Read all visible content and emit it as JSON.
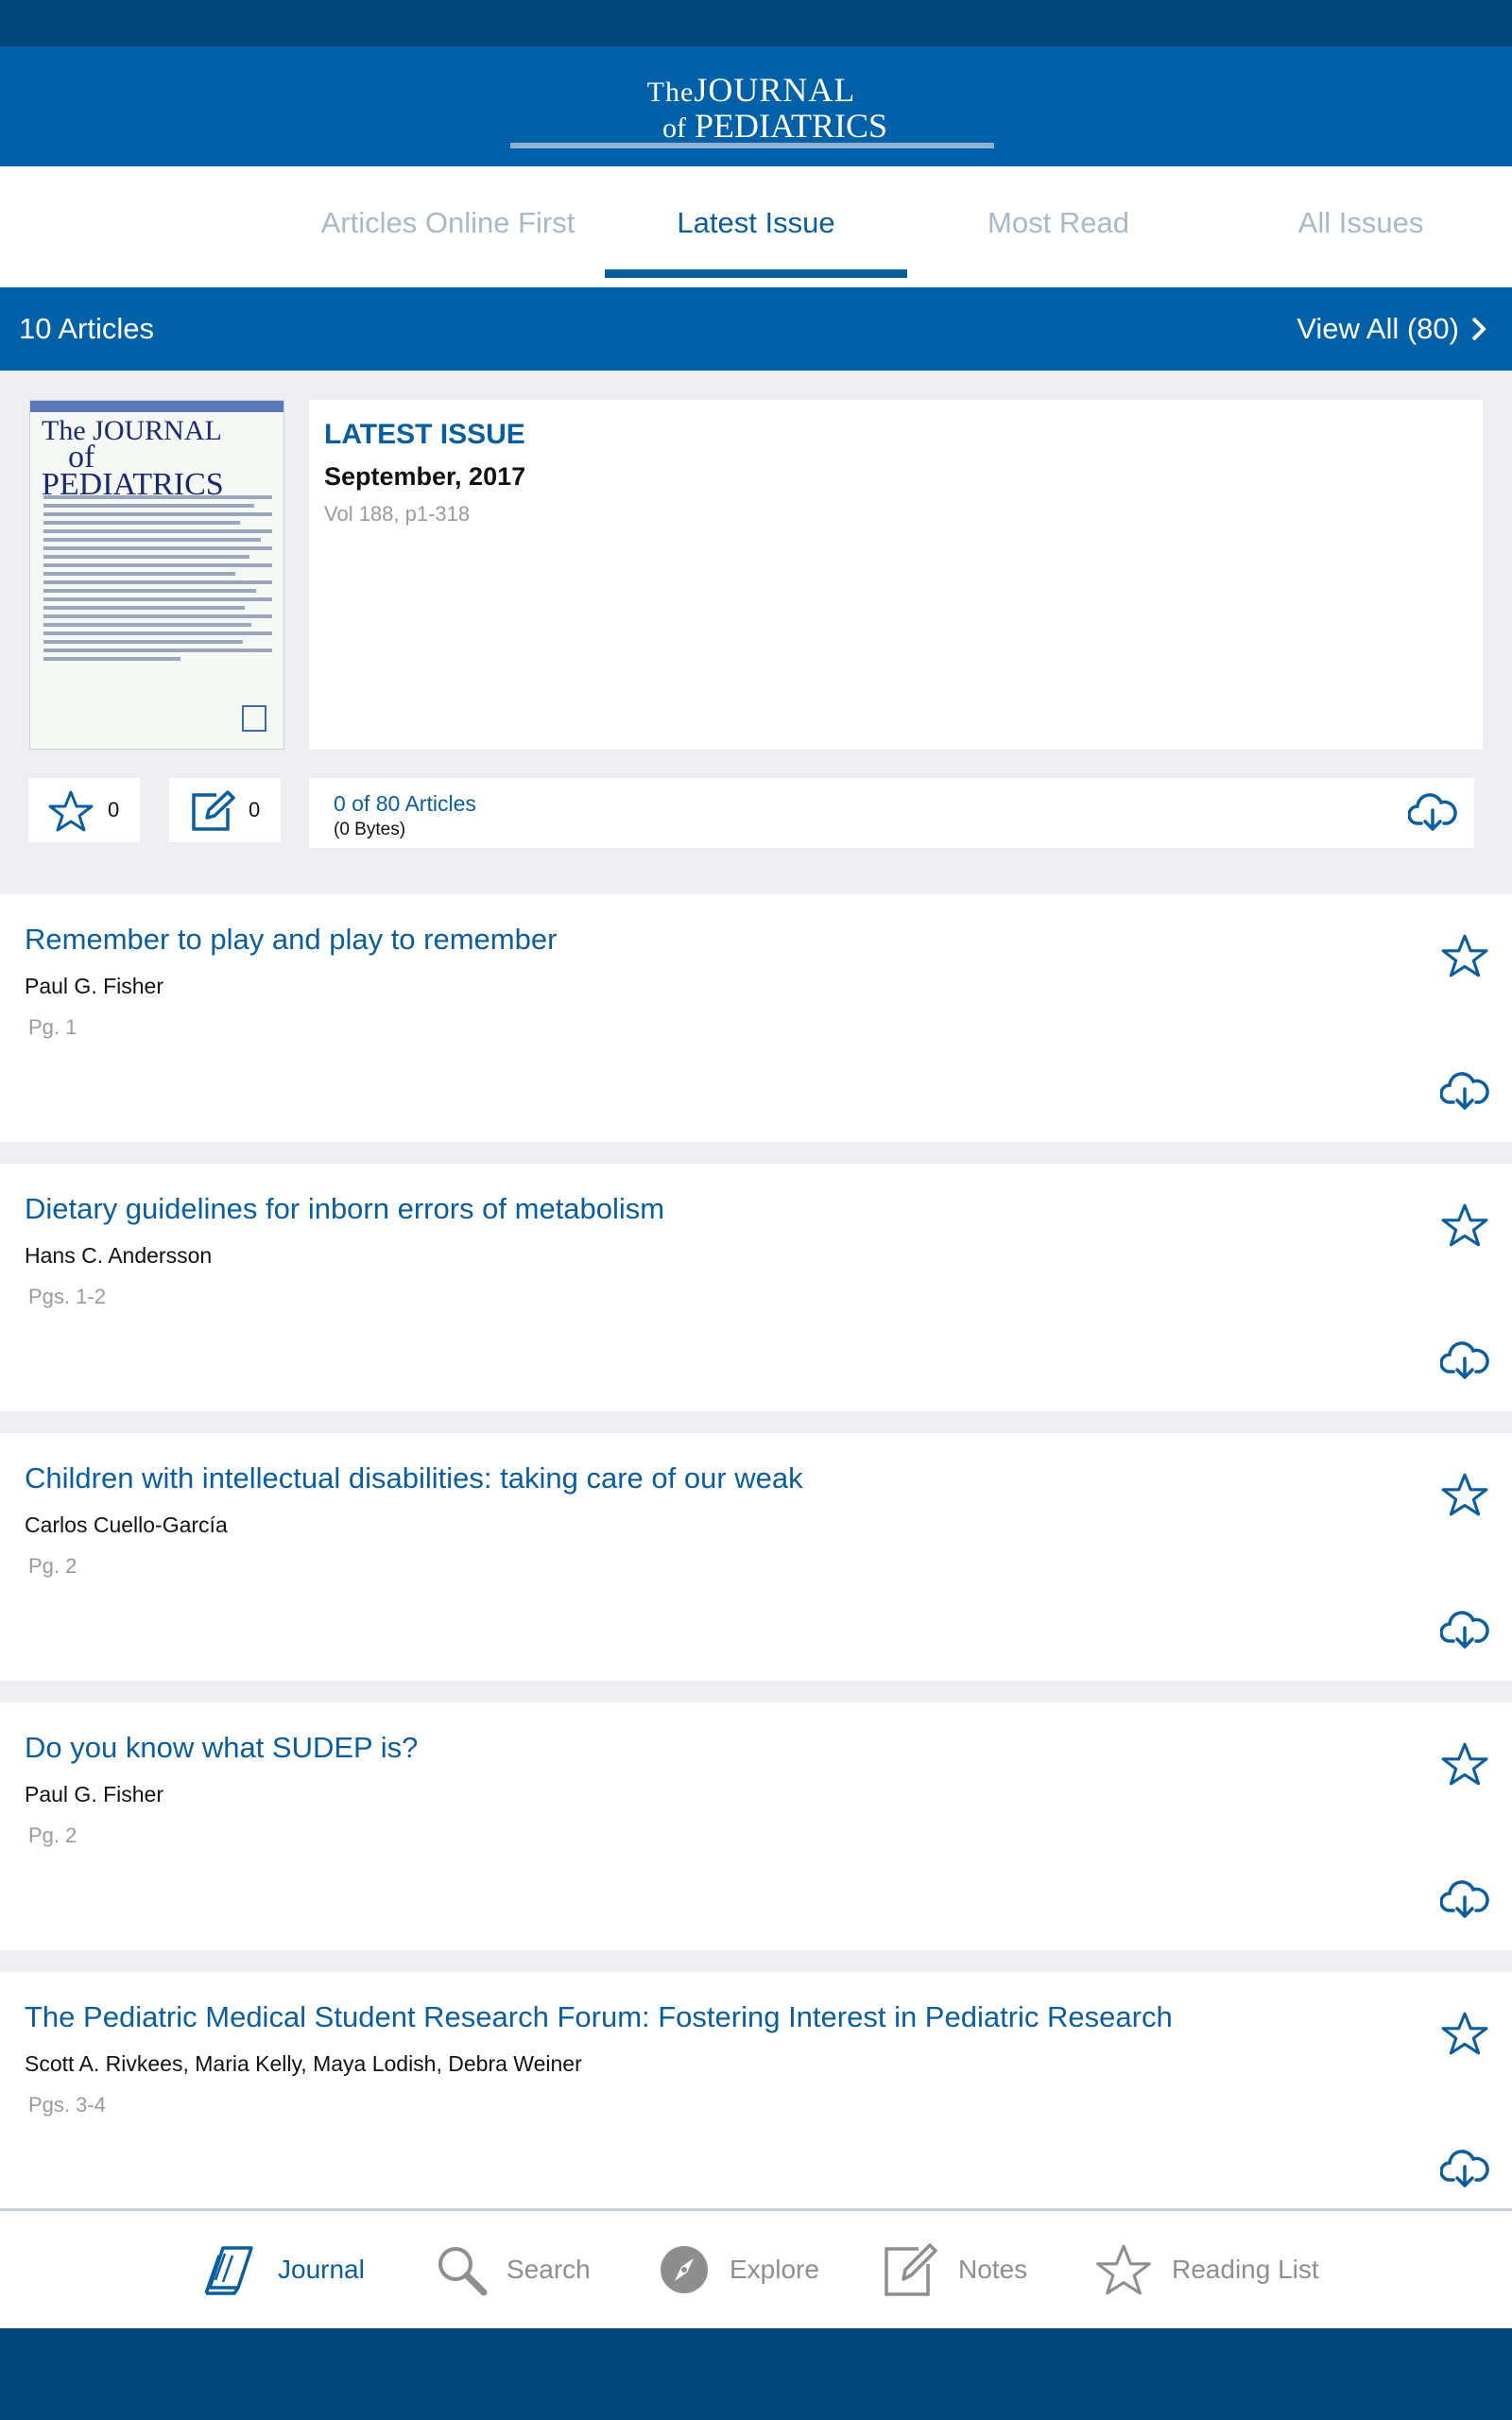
{
  "header": {
    "logo_line1_prefix": "The",
    "logo_line1_main": "JOURNAL",
    "logo_line2_prefix": "of",
    "logo_line2_main": "PEDIATRICS"
  },
  "tabs": [
    {
      "label": "Articles Online First"
    },
    {
      "label": "Latest Issue"
    },
    {
      "label": "Most Read"
    },
    {
      "label": "All Issues"
    }
  ],
  "count_bar": {
    "articles_count": "10 Articles",
    "view_all": "View All (80)"
  },
  "issue": {
    "label": "LATEST ISSUE",
    "date": "September, 2017",
    "volume": "Vol 188, p1-318",
    "cover_title_1": "The JOURNAL",
    "cover_title_2": "of PEDIATRICS"
  },
  "stats": {
    "starred_count": "0",
    "notes_count": "0",
    "downloaded": "0 of 80 Articles",
    "size": "(0 Bytes)"
  },
  "articles": [
    {
      "title": "Remember to play and play to remember",
      "authors": "Paul G. Fisher",
      "pages": "Pg. 1"
    },
    {
      "title": "Dietary guidelines for inborn errors of metabolism",
      "authors": "Hans C. Andersson",
      "pages": "Pgs. 1-2"
    },
    {
      "title": "Children with intellectual disabilities: taking care of our weak",
      "authors": "Carlos Cuello-García",
      "pages": "Pg. 2"
    },
    {
      "title": "Do you know what SUDEP is?",
      "authors": "Paul G. Fisher",
      "pages": "Pg. 2"
    },
    {
      "title": "The Pediatric Medical Student Research Forum: Fostering Interest in Pediatric Research",
      "authors": "Scott A. Rivkees, Maria Kelly, Maya Lodish, Debra Weiner",
      "pages": "Pgs. 3-4"
    }
  ],
  "bottom_nav": [
    {
      "label": "Journal",
      "icon": "journal-icon"
    },
    {
      "label": "Search",
      "icon": "search-icon"
    },
    {
      "label": "Explore",
      "icon": "compass-icon"
    },
    {
      "label": "Notes",
      "icon": "note-icon"
    },
    {
      "label": "Reading List",
      "icon": "star-icon"
    }
  ],
  "colors": {
    "brand": "#0061a8",
    "brand_dark": "#00477a",
    "link": "#0a5d9e",
    "muted": "#a8b8c8"
  }
}
